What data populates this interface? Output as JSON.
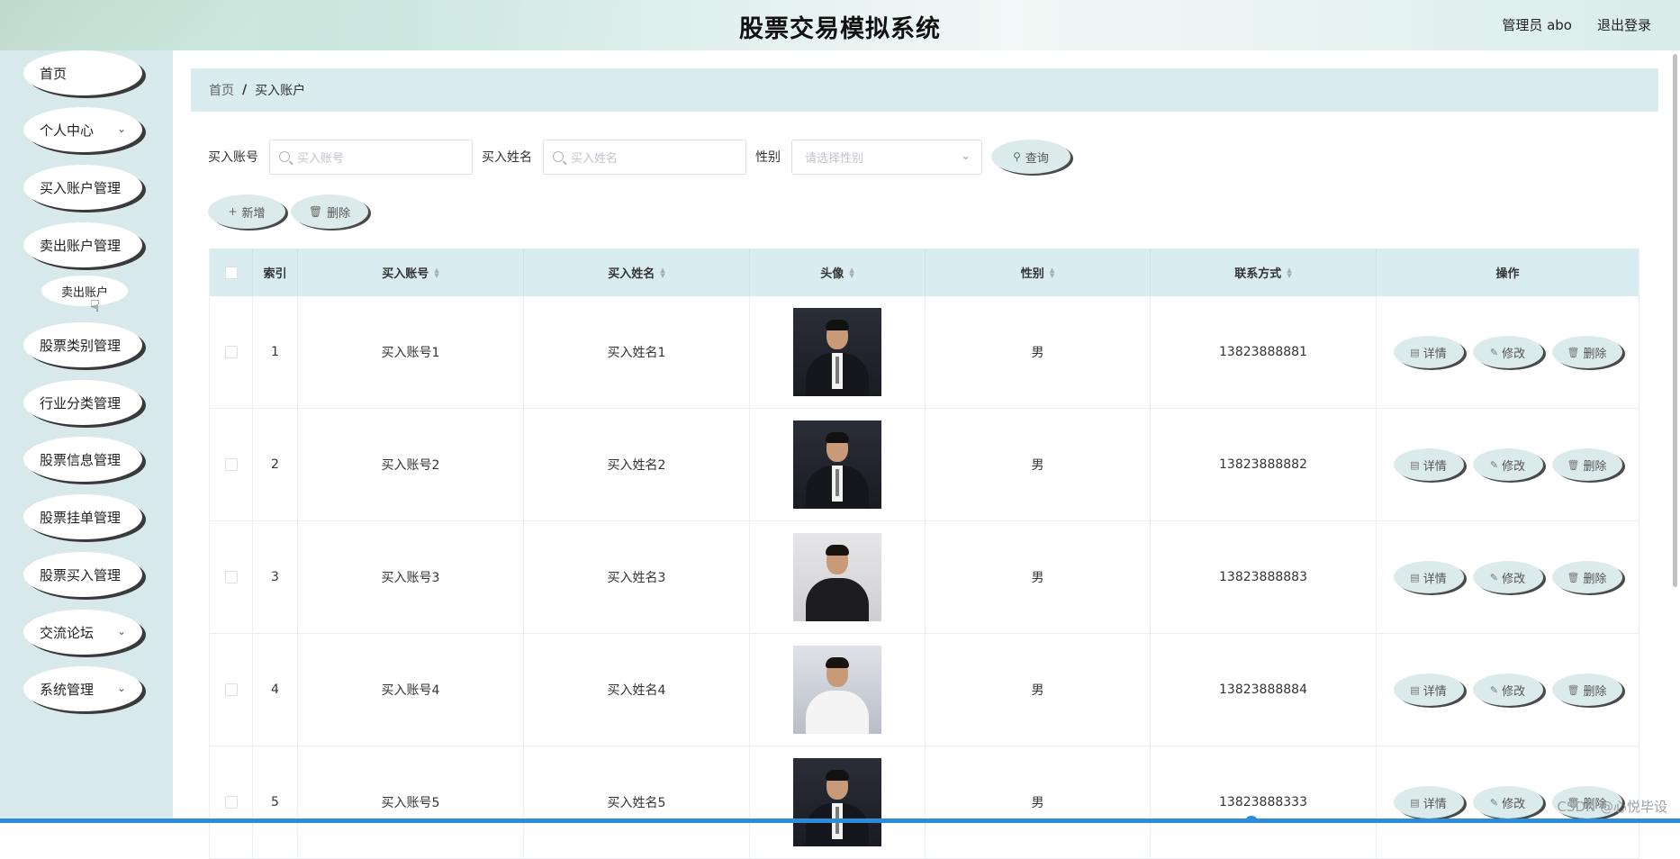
{
  "header": {
    "title": "股票交易模拟系统",
    "admin": "管理员 abo",
    "logout": "退出登录"
  },
  "sidebar": {
    "items": [
      {
        "label": "首页",
        "has_children": false
      },
      {
        "label": "个人中心",
        "has_children": true
      },
      {
        "label": "买入账户管理",
        "has_children": false
      },
      {
        "label": "卖出账户管理",
        "has_children": false
      },
      {
        "label": "股票类别管理",
        "has_children": false
      },
      {
        "label": "行业分类管理",
        "has_children": false
      },
      {
        "label": "股票信息管理",
        "has_children": false
      },
      {
        "label": "股票挂单管理",
        "has_children": false
      },
      {
        "label": "股票买入管理",
        "has_children": false
      },
      {
        "label": "交流论坛",
        "has_children": true
      },
      {
        "label": "系统管理",
        "has_children": true
      }
    ],
    "sub_item": "卖出账户"
  },
  "breadcrumb": {
    "home": "首页",
    "separator": "/",
    "current": "买入账户"
  },
  "search": {
    "account_label": "买入账号",
    "account_placeholder": "买入账号",
    "name_label": "买入姓名",
    "name_placeholder": "买入姓名",
    "gender_label": "性别",
    "gender_placeholder": "请选择性别",
    "query_button": "查询"
  },
  "actions": {
    "add": "新增",
    "delete": "删除"
  },
  "table": {
    "columns": [
      "索引",
      "买入账号",
      "买入姓名",
      "头像",
      "性别",
      "联系方式",
      "操作"
    ],
    "rows": [
      {
        "index": "1",
        "account": "买入账号1",
        "name": "买入姓名1",
        "gender": "男",
        "phone": "13823888881",
        "avatar": "man-suit"
      },
      {
        "index": "2",
        "account": "买入账号2",
        "name": "买入姓名2",
        "gender": "男",
        "phone": "13823888882",
        "avatar": "man-suit"
      },
      {
        "index": "3",
        "account": "买入账号3",
        "name": "买入姓名3",
        "gender": "男",
        "phone": "13823888883",
        "avatar": "woman-blazer"
      },
      {
        "index": "4",
        "account": "买入账号4",
        "name": "买入姓名4",
        "gender": "男",
        "phone": "13823888884",
        "avatar": "woman-white"
      },
      {
        "index": "5",
        "account": "买入账号5",
        "name": "买入姓名5",
        "gender": "男",
        "phone": "13823888333",
        "avatar": "man-suit"
      }
    ],
    "row_actions": {
      "detail": "详情",
      "edit": "修改",
      "delete": "删除"
    }
  },
  "watermark": "CSDN @心悦毕设",
  "colors": {
    "sidebar_bg": "#d7e9eb",
    "header_table_bg": "#d9ecef",
    "pill_bg": "#dbeaea",
    "accent_bottom": "#2e8bd8"
  }
}
